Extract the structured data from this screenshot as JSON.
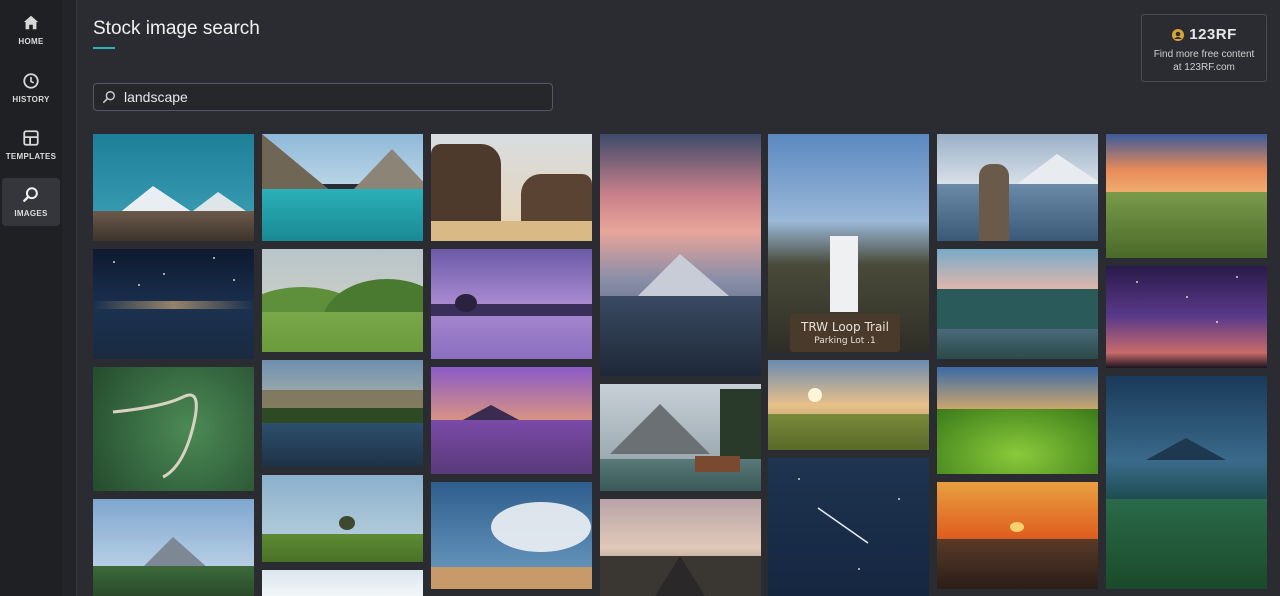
{
  "nav": {
    "items": [
      {
        "label": "HOME",
        "icon": "home-icon"
      },
      {
        "label": "HISTORY",
        "icon": "history-icon"
      },
      {
        "label": "TEMPLATES",
        "icon": "templates-icon"
      },
      {
        "label": "IMAGES",
        "icon": "search-icon",
        "active": true
      }
    ]
  },
  "page": {
    "title": "Stock image search"
  },
  "search": {
    "value": "landscape"
  },
  "promo": {
    "logo_text": "123RF",
    "line1": "Find more free content",
    "line2": "at 123RF.com"
  },
  "photos": {
    "sign_line1": "TRW Loop Trail",
    "sign_line2": "Parking Lot .1"
  },
  "colors": {
    "accent": "#2bb3c0",
    "background": "#2a2c31",
    "sidebar": "#1f2024"
  }
}
